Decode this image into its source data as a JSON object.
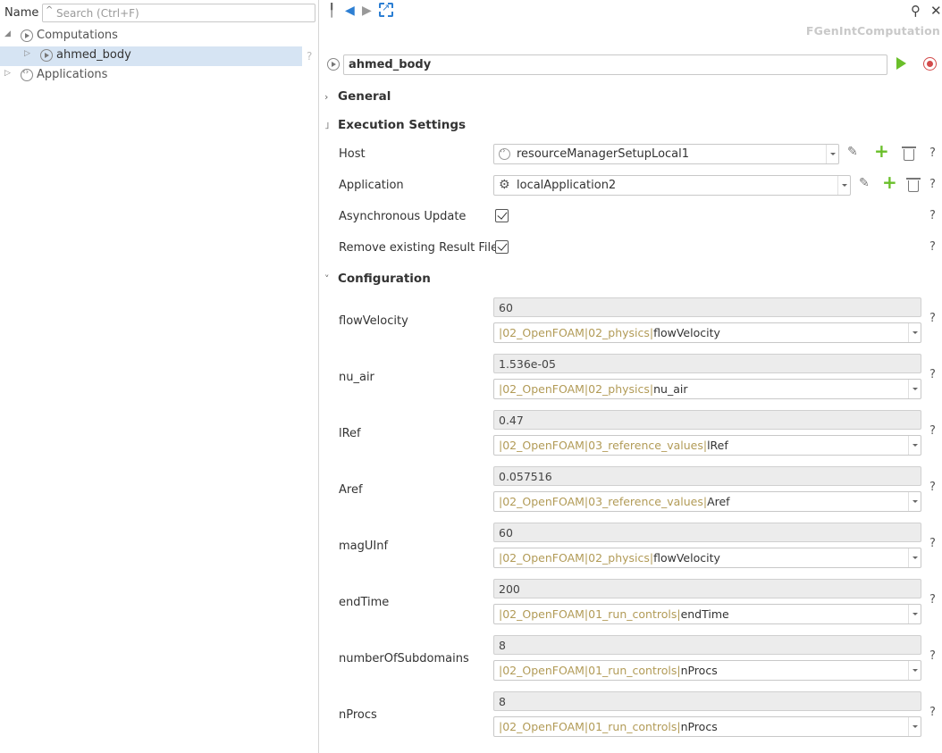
{
  "tree": {
    "header_label": "Name",
    "search_placeholder": "Search (Ctrl+F)",
    "items": [
      {
        "label": "Computations"
      },
      {
        "label": "ahmed_body",
        "help": "?"
      },
      {
        "label": "Applications"
      }
    ]
  },
  "panel": {
    "type_label": "FGenIntComputation",
    "name_value": "ahmed_body"
  },
  "sections": {
    "general": "General",
    "execution": "Execution Settings",
    "configuration": "Configuration"
  },
  "execution": {
    "host_label": "Host",
    "host_value": "resourceManagerSetupLocal1",
    "application_label": "Application",
    "application_value": "localApplication2",
    "async_label": "Asynchronous Update",
    "async_checked": true,
    "remove_label": "Remove existing Result Files",
    "remove_checked": true,
    "help": "?"
  },
  "config": [
    {
      "name": "flowVelocity",
      "value": "60",
      "path": "|02_OpenFOAM|02_physics|",
      "leaf": "flowVelocity"
    },
    {
      "name": "nu_air",
      "value": "1.536e-05",
      "path": "|02_OpenFOAM|02_physics|",
      "leaf": "nu_air"
    },
    {
      "name": "lRef",
      "value": "0.47",
      "path": "|02_OpenFOAM|03_reference_values|",
      "leaf": "lRef"
    },
    {
      "name": "Aref",
      "value": "0.057516",
      "path": "|02_OpenFOAM|03_reference_values|",
      "leaf": "Aref"
    },
    {
      "name": "magUInf",
      "value": "60",
      "path": "|02_OpenFOAM|02_physics|",
      "leaf": "flowVelocity"
    },
    {
      "name": "endTime",
      "value": "200",
      "path": "|02_OpenFOAM|01_run_controls|",
      "leaf": "endTime"
    },
    {
      "name": "numberOfSubdomains",
      "value": "8",
      "path": "|02_OpenFOAM|01_run_controls|",
      "leaf": "nProcs"
    },
    {
      "name": "nProcs",
      "value": "8",
      "path": "|02_OpenFOAM|01_run_controls|",
      "leaf": "nProcs"
    }
  ],
  "colors": {
    "accent_blue": "#2d7fd3",
    "run_green": "#6abf2a",
    "stop_red": "#d24b4b",
    "path_olive": "#b29b57",
    "selection": "#d6e4f3"
  },
  "icons": {
    "pin": "pin-icon",
    "back": "back-arrow-icon",
    "forward": "forward-arrow-icon",
    "sync": "link-with-selection-icon",
    "search": "search-icon",
    "close": "close-icon"
  }
}
